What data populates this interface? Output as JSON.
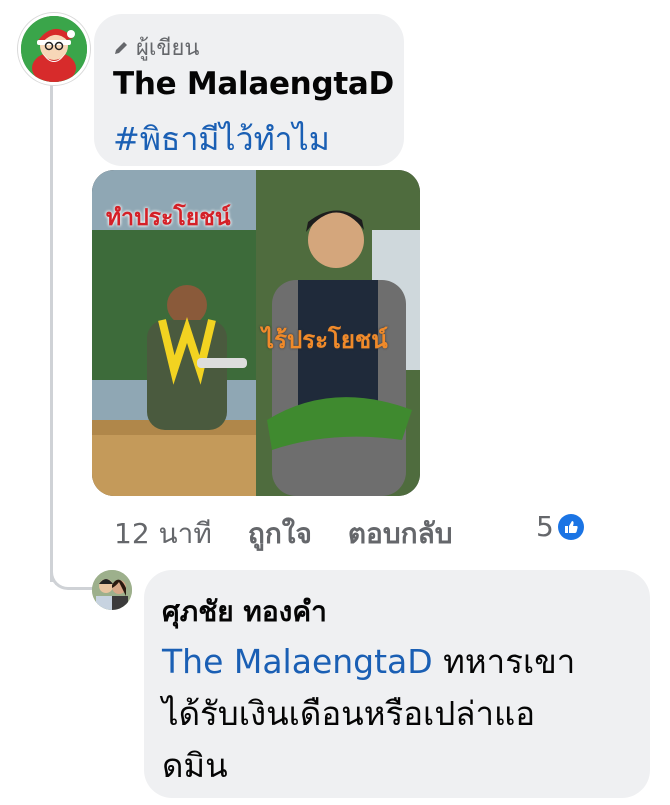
{
  "comment": {
    "author_badge": "ผู้เขียน",
    "author_name": "The MalaengtaD",
    "text": "#พิธามีไว้ทำไม",
    "image": {
      "left_caption": "ทำประโยชน์",
      "right_caption": "ไร้ประโยชน์"
    },
    "time": "12 นาที",
    "like_label": "ถูกใจ",
    "reply_label": "ตอบกลับ",
    "reaction_count": "5"
  },
  "reply": {
    "author_name": "ศุภชัย ทองคำ",
    "mention": "The MalaengtaD",
    "text_line1": " ทหารเขา",
    "text_line2": "ได้รับเงินเดือนหรือเปล่าแอ",
    "text_line3": "ดมิน"
  },
  "colors": {
    "bubble": "#eff0f2",
    "link": "#1a5fb4",
    "like_blue": "#1b74e4",
    "left_caption": "#d42027",
    "right_caption": "#f08a2a"
  }
}
